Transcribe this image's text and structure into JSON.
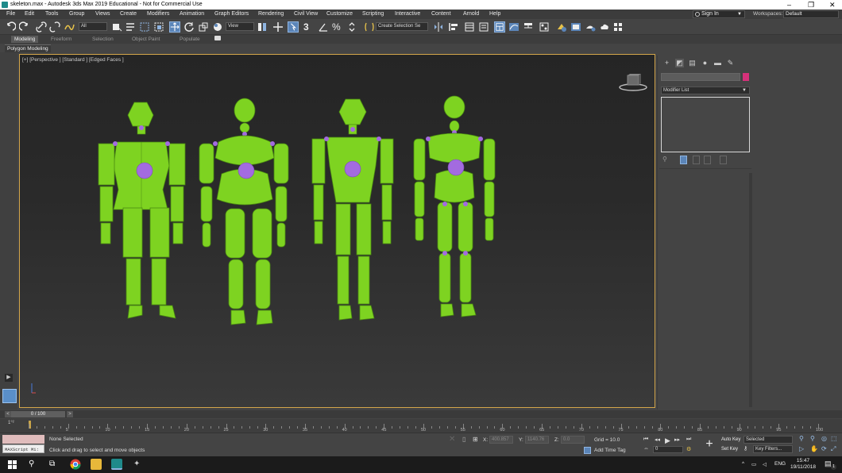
{
  "window": {
    "title": "skeleton.max - Autodesk 3ds Max 2019 Educational - Not for Commercial Use",
    "controls": [
      "–",
      "❐",
      "✕"
    ]
  },
  "menu": {
    "items": [
      "File",
      "Edit",
      "Tools",
      "Group",
      "Views",
      "Create",
      "Modifiers",
      "Animation",
      "Graph Editors",
      "Rendering",
      "Civil View",
      "Customize",
      "Scripting",
      "Interactive",
      "Content",
      "Arnold",
      "Help"
    ],
    "sign_in": "Sign In",
    "workspaces_label": "Workspaces:",
    "workspace_value": "Default"
  },
  "toolbar": {
    "filter_value": "All",
    "refcoord_value": "View",
    "named_selection_placeholder": "Create Selection Se",
    "snap_label": "3",
    "angle_label": "%"
  },
  "ribbon": {
    "tabs": [
      "Modeling",
      "Freeform",
      "Selection",
      "Object Paint",
      "Populate"
    ],
    "active_tab": "Modeling",
    "subtab": "Polygon Modeling"
  },
  "viewport": {
    "label": "[+] [Perspective ] [Standard ] [Edged Faces ]",
    "figure_color": "#7ed321",
    "joint_color": "#a36be0"
  },
  "command_panel": {
    "tab_icons": [
      "create-icon",
      "modify-icon",
      "hierarchy-icon",
      "motion-icon",
      "display-icon",
      "utilities-icon"
    ],
    "modifier_list": "Modifier List",
    "swatch_color": "#d6317a"
  },
  "timeline": {
    "frame_display": "0 / 100",
    "ticks": [
      "5",
      "10",
      "15",
      "20",
      "25",
      "30",
      "35",
      "40",
      "45",
      "50",
      "55",
      "60",
      "65",
      "70",
      "75",
      "80",
      "85",
      "90",
      "95",
      "100"
    ],
    "filter_label": "1°²"
  },
  "status": {
    "maxscript_label": "MAXScript Mi:",
    "selection_text": "None Selected",
    "prompt_text": "Click and drag to select and move objects",
    "x_label": "X:",
    "x_value": "400.857",
    "y_label": "Y:",
    "y_value": "1140.76",
    "z_label": "Z:",
    "z_value": "0.0",
    "grid": "Grid = 10.0",
    "add_time_tag": "Add Time Tag",
    "frame_value": "0",
    "auto_key": "Auto Key",
    "set_key": "Set Key",
    "selected_value": "Selected",
    "key_filters": "Key Filters..."
  },
  "taskbar": {
    "lang": "ENG",
    "time": "15:47",
    "date": "19/11/2018",
    "notif_count": "1"
  }
}
